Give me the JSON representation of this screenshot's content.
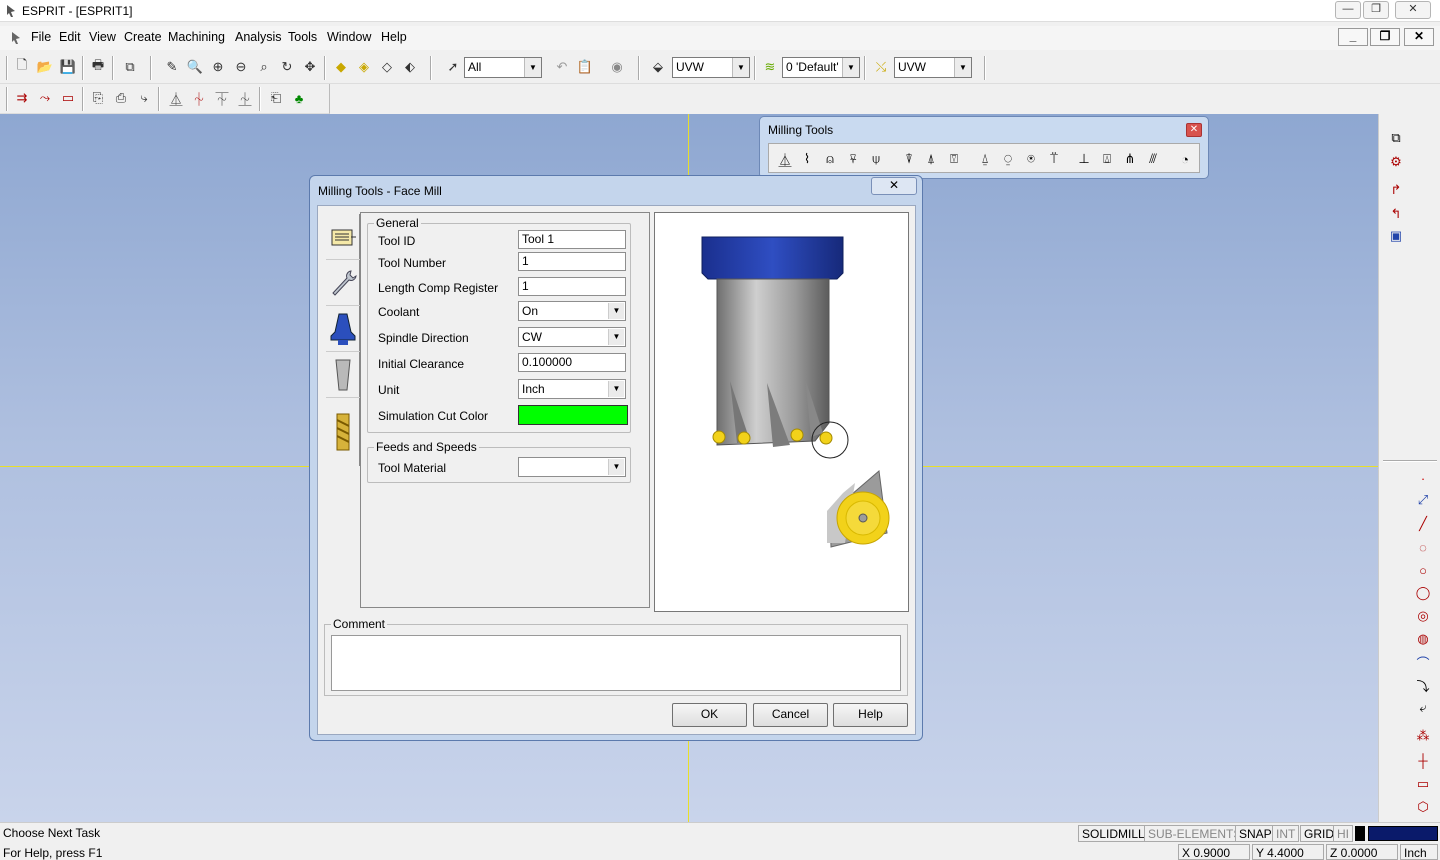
{
  "window": {
    "title": "ESPRIT - [ESPRIT1]"
  },
  "menu": [
    "File",
    "Edit",
    "View",
    "Create",
    "Machining",
    "Analysis",
    "Tools",
    "Window",
    "Help"
  ],
  "toolbar": {
    "filter_value": "All",
    "workplane_value": "UVW",
    "layer_value": "0 'Default'",
    "workplane2_value": "UVW"
  },
  "milling_toolbar": {
    "title": "Milling Tools"
  },
  "dialog": {
    "title": "Milling Tools - Face Mill",
    "close_label": "✕",
    "general": {
      "legend": "General",
      "tool_id_label": "Tool ID",
      "tool_id_value": "Tool 1",
      "tool_number_label": "Tool Number",
      "tool_number_value": "1",
      "length_comp_label": "Length Comp Register",
      "length_comp_value": "1",
      "coolant_label": "Coolant",
      "coolant_value": "On",
      "spindle_label": "Spindle Direction",
      "spindle_value": "CW",
      "clearance_label": "Initial Clearance",
      "clearance_value": "0.100000",
      "unit_label": "Unit",
      "unit_value": "Inch",
      "sim_color_label": "Simulation Cut Color",
      "sim_color": "#00ff00"
    },
    "feeds": {
      "legend": "Feeds and Speeds",
      "tool_material_label": "Tool Material",
      "tool_material_value": ""
    },
    "comment_label": "Comment",
    "buttons": {
      "ok": "OK",
      "cancel": "Cancel",
      "help": "Help"
    }
  },
  "status": {
    "message": "Choose Next Task",
    "help": "For Help, press F1",
    "modes": [
      "SOLIDMILL",
      "SUB-ELEMENTS",
      "SNAP",
      "INT",
      "GRID",
      "HI"
    ],
    "x": "X 0.9000",
    "y": "Y 4.4000",
    "z": "Z 0.0000",
    "unit": "Inch"
  },
  "colors": {
    "workspace_top": "#8ea7d1",
    "axis": "#e8df2a",
    "cutter_body": "#1f36a0",
    "insert": "#f2d21a"
  }
}
